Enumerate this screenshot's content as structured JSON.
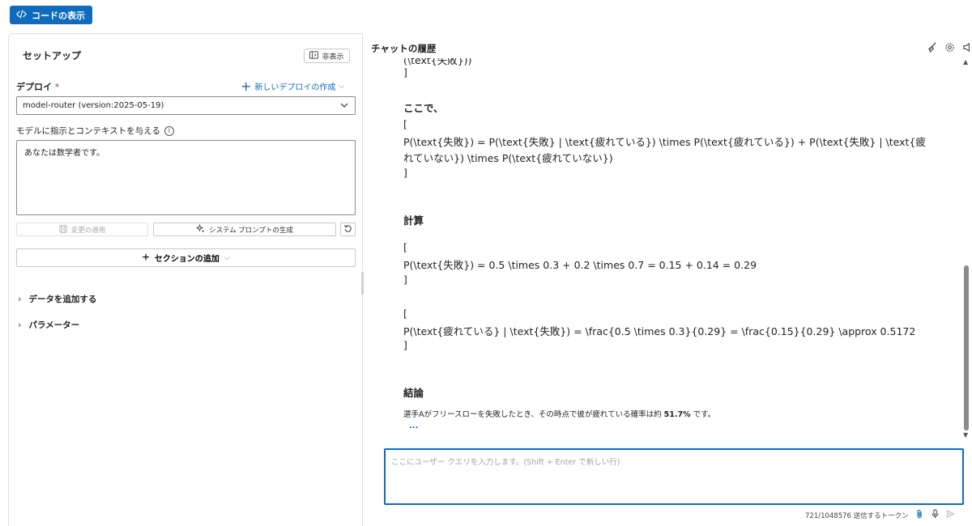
{
  "topbar": {
    "code_button_label": "コードの表示"
  },
  "setup": {
    "title": "セットアップ",
    "hide_button_label": "非表示",
    "deploy_label": "デプロイ",
    "required_mark": "*",
    "new_deploy_label": "新しいデプロイの作成",
    "deploy_selected": "model-router (version:2025-05-19)",
    "instructions_label": "モデルに指示とコンテキストを与える",
    "system_message": "あなたは数学者です。",
    "apply_changes_label": "変更の適用",
    "generate_prompt_label": "システム プロンプトの生成",
    "add_section_label": "セクションの追加",
    "expanders": [
      "データを追加する",
      "パラメーター"
    ]
  },
  "chat": {
    "title": "チャットの履歴",
    "lines": {
      "cut_line": "(\\text{失敗}))",
      "bracket_close_1": "]",
      "here_heading": "ここで、",
      "bracket_open_2": "[",
      "formula_2a": "P(\\text{失敗}) = P(\\text{失敗} | \\text{疲れている}) \\times P(\\text{疲れている}) + P(\\text{失敗} | \\text{疲",
      "formula_2b": "れていない}) \\times P(\\text{疲れていない})",
      "bracket_close_2": "]",
      "calc_heading": "計算",
      "bracket_open_3": "[",
      "formula_3": "P(\\text{失敗}) = 0.5 \\times 0.3 + 0.2 \\times 0.7 = 0.15 + 0.14 = 0.29",
      "bracket_close_3": "]",
      "bracket_open_4": "[",
      "formula_4": "P(\\text{疲れている} | \\text{失敗}) = \\frac{0.5 \\times 0.3}{0.29} = \\frac{0.15}{0.29} \\approx 0.5172",
      "bracket_close_4": "]",
      "conclusion_heading": "結論",
      "conclusion_pre": "選手Aがフリースローを失敗したとき、その時点で彼が疲れている確率は約 ",
      "conclusion_value": "51.7%",
      "conclusion_post": " です。",
      "ellipsis": "..."
    },
    "input_placeholder": "ここにユーザー クエリを入力します。(Shift + Enter で新しい行)",
    "token_count": "721/1048576 送信するトークン"
  },
  "icons": [
    "code-icon",
    "panel-icon",
    "plus-icon",
    "chevron-down-icon",
    "info-icon",
    "save-icon",
    "sparkle-icon",
    "reset-icon",
    "broom-icon",
    "gear-icon",
    "speaker-icon",
    "attach-icon",
    "mic-icon",
    "send-icon"
  ],
  "colors": {
    "accent": "#0f6cbd",
    "required": "#c4314b"
  }
}
